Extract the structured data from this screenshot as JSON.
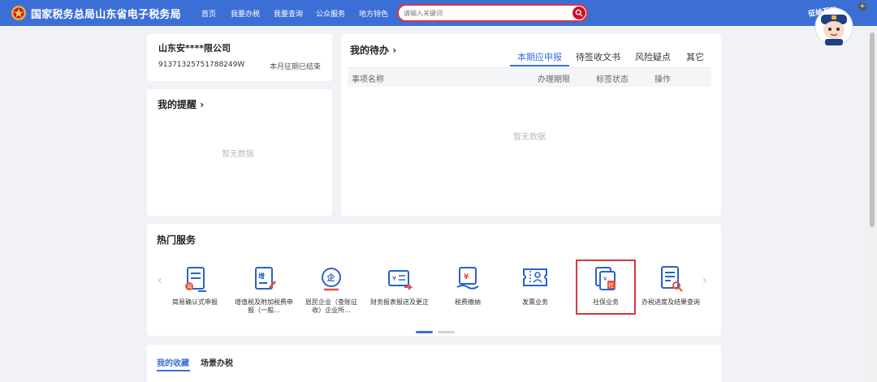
{
  "header": {
    "site_title": "国家税务总局山东省电子税务局",
    "nav": [
      "首页",
      "我要办税",
      "我要查询",
      "公众服务",
      "地方特色"
    ],
    "search_placeholder": "请输入关键词",
    "mascot_label": "征纳互动"
  },
  "company": {
    "name": "山东安****限公司",
    "tax_id": "91371325751788249W",
    "period_status": "本月征期已结束"
  },
  "reminders": {
    "title": "我的提醒",
    "chevron": "›",
    "empty": "暂无数据"
  },
  "todo": {
    "title": "我的待办",
    "chevron": "›",
    "tabs": [
      "本期应申报",
      "待签收文书",
      "风险疑点",
      "其它"
    ],
    "active_tab": "本期应申报",
    "columns": [
      "事项名称",
      "办理期限",
      "标签状态",
      "操作"
    ],
    "empty": "暂无数据"
  },
  "hot_services": {
    "title": "热门服务",
    "items": [
      "简易确认式申报",
      "增值税及附加税费申报（一般...",
      "居民企业（查账征收）企业所...",
      "财务报表报送及更正",
      "税费缴纳",
      "发票业务",
      "社保业务",
      "办税进度及结果查询"
    ],
    "prev_arrow": "‹",
    "next_arrow": "›"
  },
  "bottom_tabs": [
    "我的收藏",
    "场景办税"
  ],
  "colors": {
    "brand_blue": "#3b6fd6",
    "highlight_red": "#d9363e",
    "icon_blue": "#2a62c9"
  }
}
